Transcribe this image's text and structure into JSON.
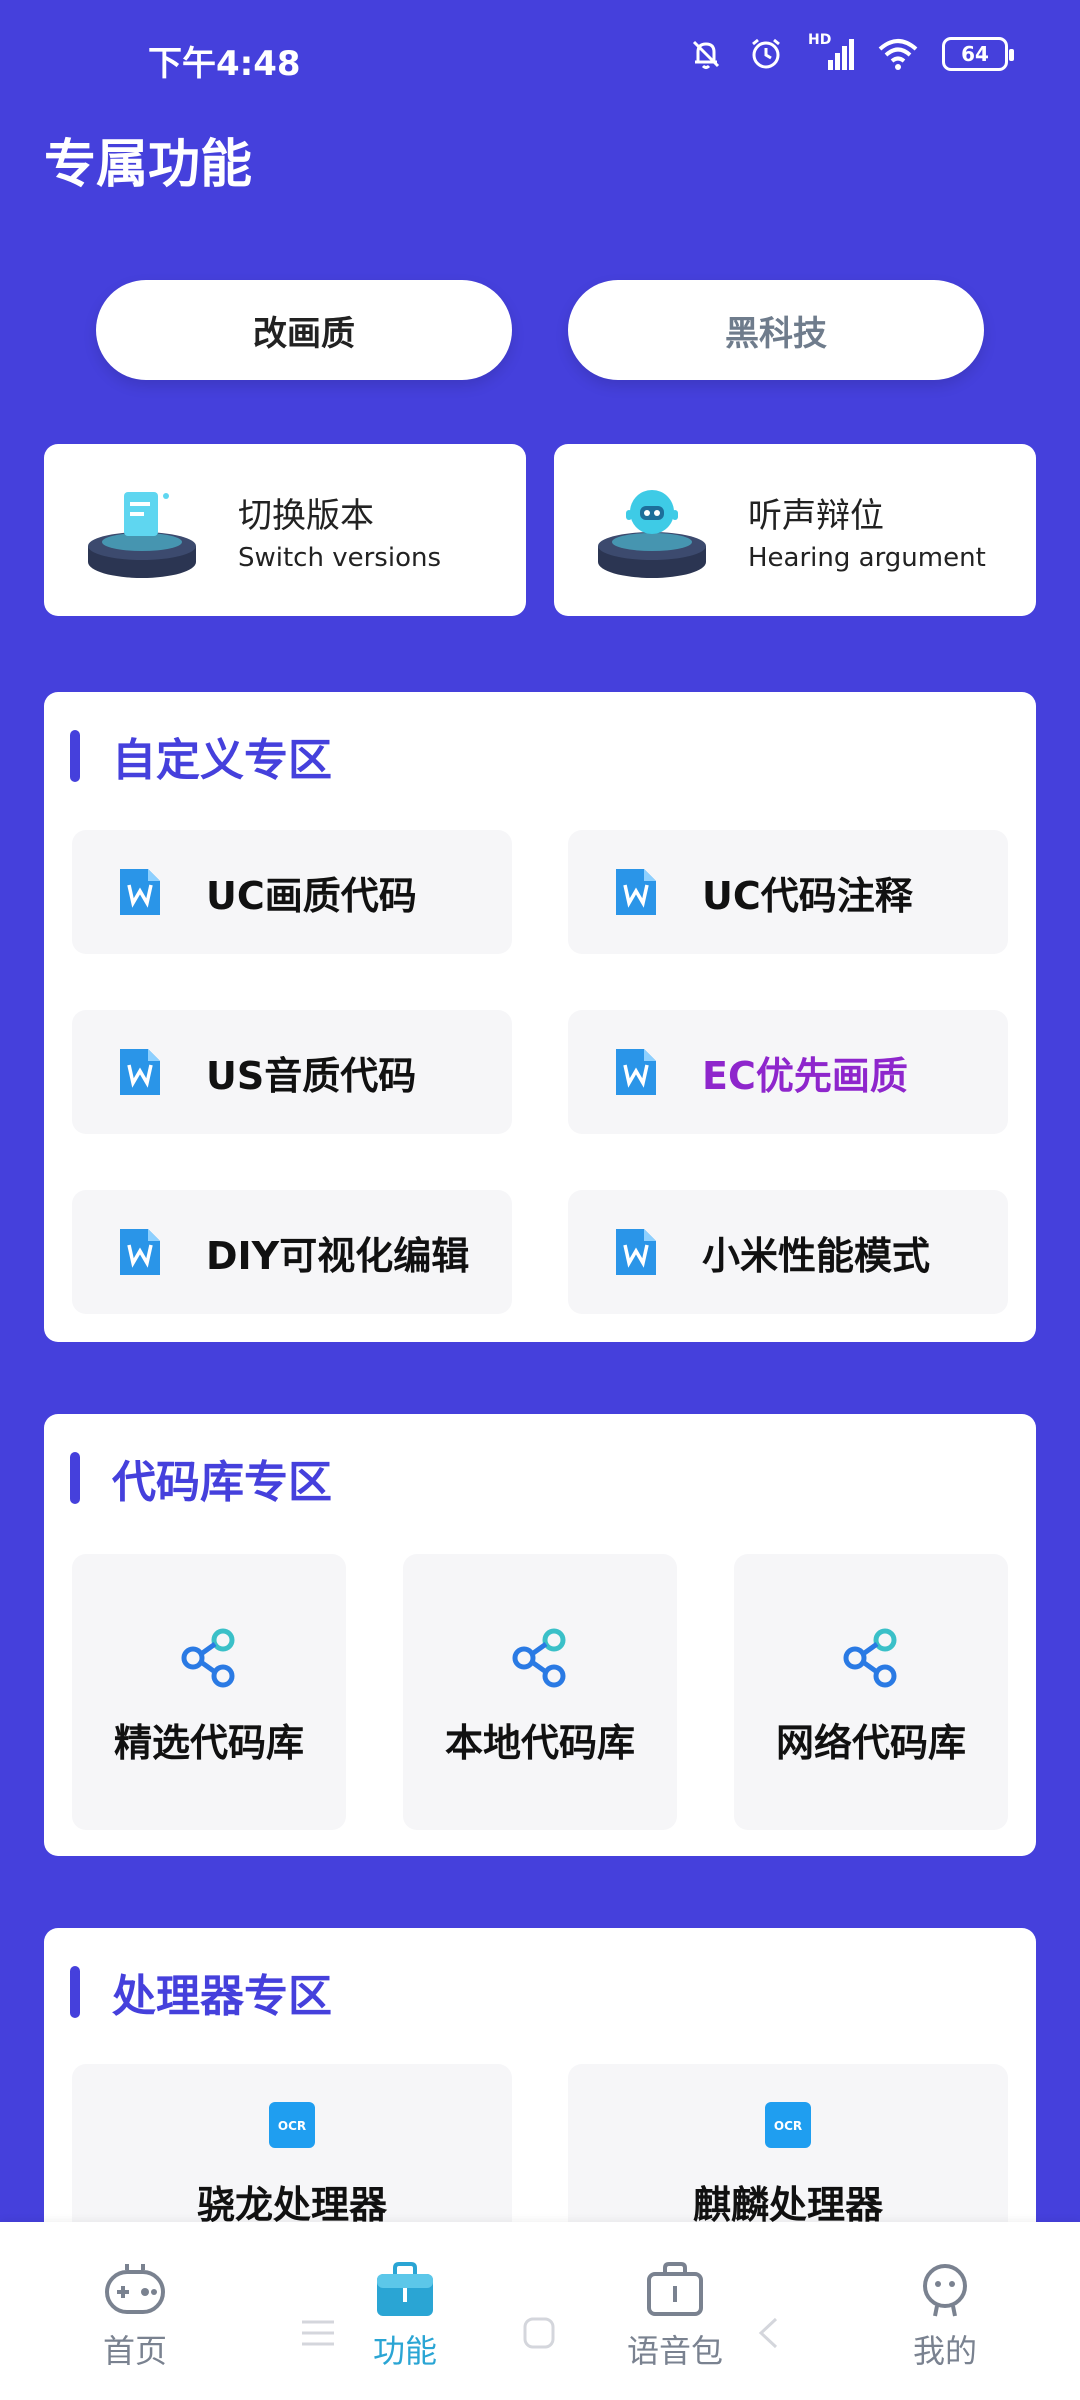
{
  "status_bar": {
    "time": "下午4:48",
    "battery": "64",
    "network": "HD"
  },
  "page_title": "专属功能",
  "pills": [
    {
      "label": "改画质"
    },
    {
      "label": "黑科技"
    }
  ],
  "top_cards": [
    {
      "title": "切换版本",
      "subtitle": "Switch versions"
    },
    {
      "title": "听声辩位",
      "subtitle": "Hearing argument"
    }
  ],
  "custom_section": {
    "title": "自定义专区",
    "items": [
      {
        "label": "UC画质代码"
      },
      {
        "label": "UC代码注释"
      },
      {
        "label": "US音质代码"
      },
      {
        "label": "EC优先画质"
      },
      {
        "label": "DIY可视化编辑"
      },
      {
        "label": "小米性能模式"
      }
    ]
  },
  "library_section": {
    "title": "代码库专区",
    "items": [
      {
        "label": "精选代码库"
      },
      {
        "label": "本地代码库"
      },
      {
        "label": "网络代码库"
      }
    ]
  },
  "cpu_section": {
    "title": "处理器专区",
    "items": [
      {
        "label": "骁龙处理器",
        "badge": "OCR"
      },
      {
        "label": "麒麟处理器",
        "badge": "OCR"
      }
    ]
  },
  "bottom_nav": {
    "items": [
      {
        "label": "首页"
      },
      {
        "label": "功能"
      },
      {
        "label": "语音包"
      },
      {
        "label": "我的"
      }
    ]
  },
  "colors": {
    "primary": "#4540dc",
    "active": "#2aa5d4",
    "purple_text": "#8e26cc"
  }
}
